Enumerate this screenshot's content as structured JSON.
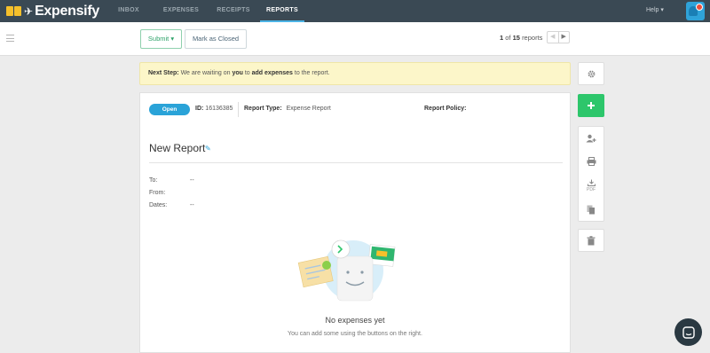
{
  "brand": {
    "name": "Expensify"
  },
  "nav": {
    "tabs": [
      {
        "label": "INBOX"
      },
      {
        "label": "EXPENSES"
      },
      {
        "label": "RECEIPTS"
      },
      {
        "label": "REPORTS",
        "active": true
      }
    ],
    "help_label": "Help"
  },
  "toolbar": {
    "submit_label": "Submit",
    "mark_closed_label": "Mark as Closed",
    "pager": {
      "current": "1",
      "of_label": "of",
      "total": "15",
      "suffix": "reports"
    }
  },
  "next_step": {
    "label": "Next Step:",
    "text_before": "We are waiting on",
    "who": "you",
    "text_middle": "to",
    "action": "add expenses",
    "text_after": "to the report."
  },
  "report": {
    "status": "Open",
    "id_label": "ID:",
    "id_value": "16136385",
    "type_label": "Report Type:",
    "type_value": "Expense Report",
    "policy_label": "Report Policy:",
    "policy_value": "",
    "title": "New Report",
    "fields": [
      {
        "label": "To:",
        "value": "--"
      },
      {
        "label": "From:",
        "value": ""
      },
      {
        "label": "Dates:",
        "value": "--"
      }
    ],
    "empty_title": "No expenses yet",
    "empty_subtitle": "You can add some using the buttons on the right."
  },
  "side_actions": {
    "pdf_label": "PDF"
  },
  "colors": {
    "nav_bg": "#3a4954",
    "accent_blue": "#2aa3d8",
    "add_green": "#2dc66b",
    "next_step_bg": "#fcf6c9"
  },
  "icons": [
    "gear-icon",
    "plus-icon",
    "add-user-icon",
    "print-icon",
    "download-pdf-icon",
    "copy-icon",
    "trash-icon",
    "pencil-icon",
    "chat-icon"
  ]
}
